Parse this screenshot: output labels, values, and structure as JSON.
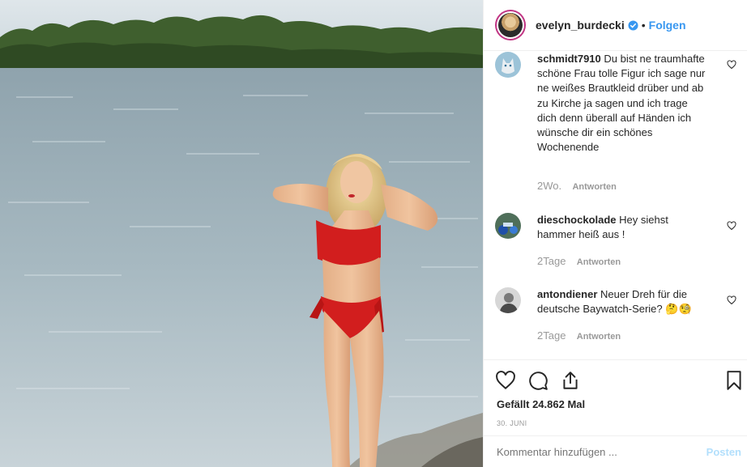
{
  "post": {
    "image_alt": "Woman in red bikini standing at a lake shore",
    "header": {
      "username": "evelyn_burdecki",
      "verified": true,
      "separator": "•",
      "follow_label": "Folgen"
    },
    "comments": [
      {
        "username": "schmidt7910",
        "text": "Du bist ne traumhafte schöne Frau tolle Figur ich sage nur ne weißes Brautkleid drüber und ab zu Kirche ja sagen und ich trage dich denn überall auf Händen ich wünsche dir ein schönes Wochenende",
        "time": "2Wo.",
        "reply_label": "Antworten",
        "avatar_icon": "wolf-avatar"
      },
      {
        "username": "dieschockolade",
        "text": "Hey siehst hammer heiß aus !",
        "time": "2Tage",
        "reply_label": "Antworten",
        "avatar_icon": "motorbike-avatar"
      },
      {
        "username": "antondiener",
        "text": "Neuer Dreh für die deutsche Baywatch-Serie? 🤔🧐",
        "time": "2Tage",
        "reply_label": "Antworten",
        "avatar_icon": "portrait-avatar"
      }
    ],
    "actions": {
      "like_icon": "heart-icon",
      "comment_icon": "comment-icon",
      "share_icon": "share-icon",
      "save_icon": "bookmark-icon"
    },
    "likes_text": "Gefällt 24.862 Mal",
    "date": "30. JUNI",
    "add_comment": {
      "placeholder": "Kommentar hinzufügen ...",
      "post_label": "Posten"
    },
    "colors": {
      "link_blue": "#3897f0",
      "post_disabled": "#b2dffc",
      "muted": "#999999",
      "border": "#efefef",
      "bikini_red": "#d21e1e"
    }
  }
}
